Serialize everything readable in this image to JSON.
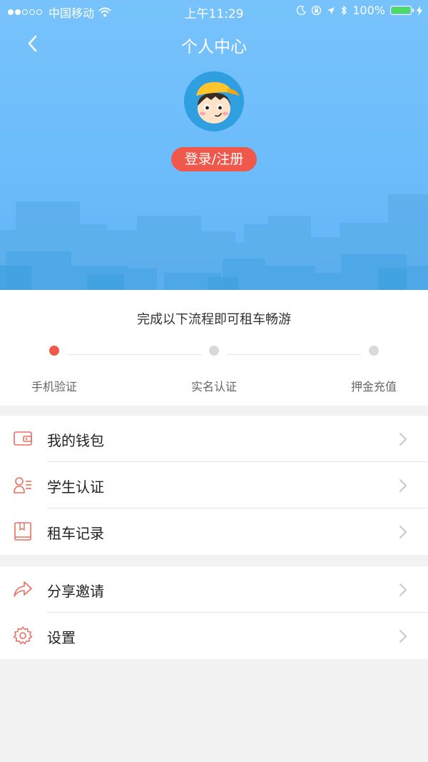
{
  "status_bar": {
    "carrier": "中国移动",
    "time": "上午11:29",
    "battery_pct": "100%",
    "battery_level": 1.0
  },
  "header": {
    "title": "个人中心",
    "login_label": "登录/注册"
  },
  "progress": {
    "title": "完成以下流程即可租车畅游",
    "steps": [
      {
        "label": "手机验证",
        "active": true
      },
      {
        "label": "实名认证",
        "active": false
      },
      {
        "label": "押金充值",
        "active": false
      }
    ]
  },
  "menu": {
    "group1": [
      {
        "label": "我的钱包",
        "icon": "wallet-icon"
      },
      {
        "label": "学生认证",
        "icon": "student-id-icon"
      },
      {
        "label": "租车记录",
        "icon": "record-book-icon"
      }
    ],
    "group2": [
      {
        "label": "分享邀请",
        "icon": "share-icon"
      },
      {
        "label": "设置",
        "icon": "settings-gear-icon"
      }
    ]
  },
  "colors": {
    "header_blue": "#6cbcfb",
    "accent_red": "#f0584c",
    "icon_red": "#ea6e60",
    "inactive_dot": "#d9d9d9"
  }
}
